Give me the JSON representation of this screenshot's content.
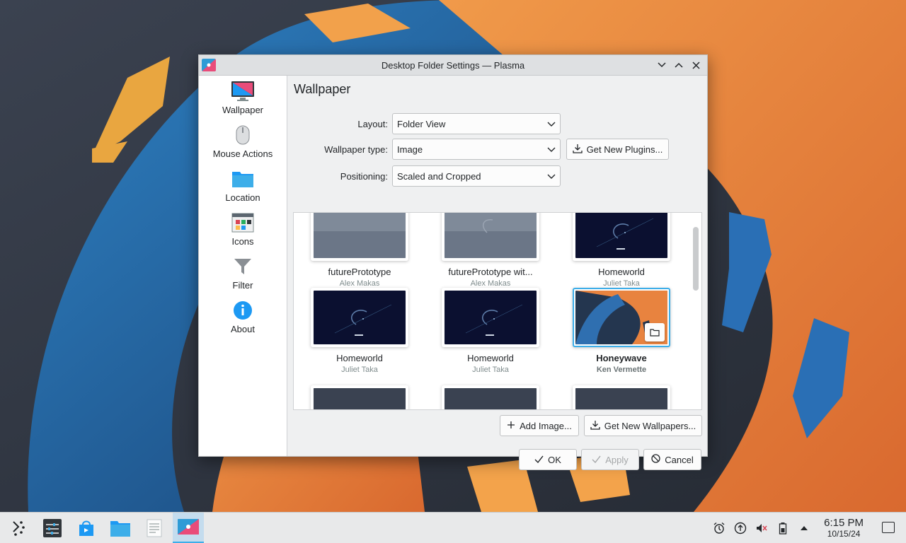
{
  "window": {
    "title": "Desktop Folder Settings — Plasma",
    "buttons": [
      "minimize-icon",
      "maximize-icon",
      "close-icon"
    ]
  },
  "sidebar": {
    "items": [
      {
        "label": "Wallpaper",
        "icon": "monitor-icon"
      },
      {
        "label": "Mouse Actions",
        "icon": "mouse-icon"
      },
      {
        "label": "Location",
        "icon": "folder-icon"
      },
      {
        "label": "Icons",
        "icon": "icons-grid-icon"
      },
      {
        "label": "Filter",
        "icon": "funnel-icon"
      },
      {
        "label": "About",
        "icon": "info-icon"
      }
    ]
  },
  "page": {
    "title": "Wallpaper",
    "layout_label": "Layout:",
    "layout_value": "Folder View",
    "type_label": "Wallpaper type:",
    "type_value": "Image",
    "get_plugins": "Get New Plugins...",
    "positioning_label": "Positioning:",
    "positioning_value": "Scaled and Cropped"
  },
  "wallpapers": [
    {
      "name": "futurePrototype",
      "author": "Alex Makas",
      "style": "gray",
      "selected": false
    },
    {
      "name": "futurePrototype wit...",
      "author": "Alex Makas",
      "style": "gray-swirl",
      "selected": false
    },
    {
      "name": "Homeworld",
      "author": "Juliet Taka",
      "style": "navy",
      "selected": false
    },
    {
      "name": "Homeworld",
      "author": "Juliet Taka",
      "style": "navy",
      "selected": false
    },
    {
      "name": "Homeworld",
      "author": "Juliet Taka",
      "style": "navy",
      "selected": false
    },
    {
      "name": "Honeywave",
      "author": "Ken Vermette",
      "style": "honeywave",
      "selected": true
    },
    {
      "name": "",
      "author": "",
      "style": "dark-gray",
      "selected": false
    },
    {
      "name": "",
      "author": "",
      "style": "dark-gray",
      "selected": false
    },
    {
      "name": "",
      "author": "",
      "style": "dark-gray",
      "selected": false
    }
  ],
  "actions": {
    "add_image": "Add Image...",
    "get_wallpapers": "Get New Wallpapers...",
    "ok": "OK",
    "apply": "Apply",
    "cancel": "Cancel"
  },
  "taskbar": {
    "items": [
      "app-launcher-icon",
      "system-settings-icon",
      "discover-icon",
      "file-manager-icon",
      "text-editor-icon",
      "plasma-settings-icon"
    ],
    "active_index": 5,
    "tray": [
      "alarm-icon",
      "update-icon",
      "volume-muted-icon",
      "battery-icon",
      "expand-tray-icon"
    ],
    "time": "6:15 PM",
    "date": "10/15/24"
  },
  "colors": {
    "accent": "#3daee9",
    "wallpaper_orange": "#e8833f",
    "wallpaper_blue": "#1f5c9e"
  }
}
